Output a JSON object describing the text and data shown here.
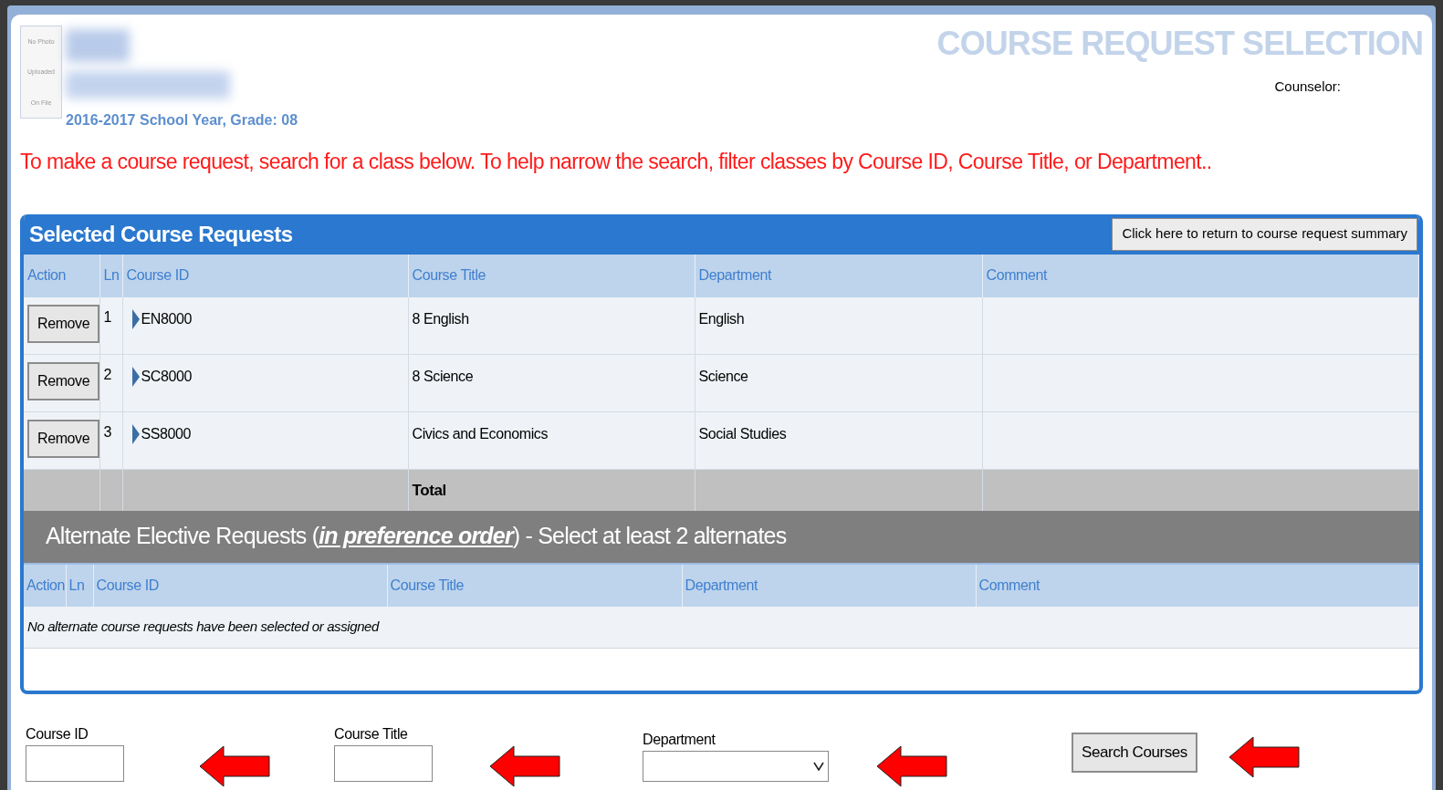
{
  "header": {
    "photo_placeholder": [
      "No Photo",
      "Uploaded",
      "On File"
    ],
    "school_year": "2016-2017 School Year, Grade: 08",
    "page_title": "COURSE REQUEST SELECTION",
    "counselor_label": "Counselor:",
    "instructions": "To make a course request, search for a class below. To help narrow the search, filter classes by Course ID, Course Title, or Department.."
  },
  "selected": {
    "title": "Selected Course Requests",
    "return_button": "Click here to return to course request summary",
    "columns": [
      "Action",
      "Ln",
      "Course ID",
      "Course Title",
      "Department",
      "Comment"
    ],
    "rows": [
      {
        "action": "Remove",
        "ln": "1",
        "course_id": "EN8000",
        "course_title": "8 English",
        "department": "English"
      },
      {
        "action": "Remove",
        "ln": "2",
        "course_id": "SC8000",
        "course_title": "8 Science",
        "department": "Science"
      },
      {
        "action": "Remove",
        "ln": "3",
        "course_id": "SS8000",
        "course_title": "Civics and Economics",
        "department": "Social Studies"
      }
    ],
    "total_label": "Total"
  },
  "alternates": {
    "title_start": "Alternate Elective Requests (",
    "title_link": "in preference order",
    "title_end": ") - Select at least 2 alternates",
    "columns": [
      "Action",
      "Ln",
      "Course ID",
      "Course Title",
      "Department",
      "Comment"
    ],
    "empty_message": "No alternate course requests have been selected or assigned"
  },
  "search": {
    "fields": [
      {
        "label": "Course ID",
        "kind": "text"
      },
      {
        "label": "Course Title",
        "kind": "text"
      },
      {
        "label": "Department",
        "kind": "select"
      }
    ],
    "button": "Search Courses"
  }
}
